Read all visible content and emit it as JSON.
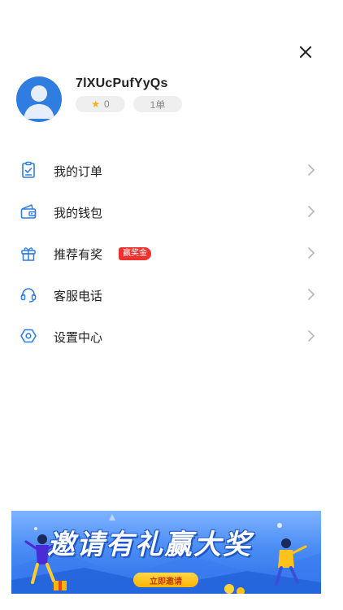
{
  "icons": {
    "close": "close-icon",
    "avatar": "user-avatar-icon",
    "star": "star-icon",
    "chevron": "chevron-right-icon"
  },
  "colors": {
    "accent": "#2f7de1",
    "badge": "#f0322e",
    "star": "#f5b400",
    "pill_bg": "#efefef"
  },
  "profile": {
    "username": "7lXUcPufYyQs",
    "rating": "0",
    "orders": "1单"
  },
  "menu": {
    "items": [
      {
        "label": "我的订单",
        "icon": "clipboard-check-icon"
      },
      {
        "label": "我的钱包",
        "icon": "wallet-icon"
      },
      {
        "label": "推荐有奖",
        "icon": "gift-icon",
        "badge": "赢奖金"
      },
      {
        "label": "客服电话",
        "icon": "headset-icon"
      },
      {
        "label": "设置中心",
        "icon": "hexagon-settings-icon"
      }
    ]
  },
  "banner": {
    "title": "邀请有礼赢大奖",
    "button_label": "立即邀请"
  }
}
